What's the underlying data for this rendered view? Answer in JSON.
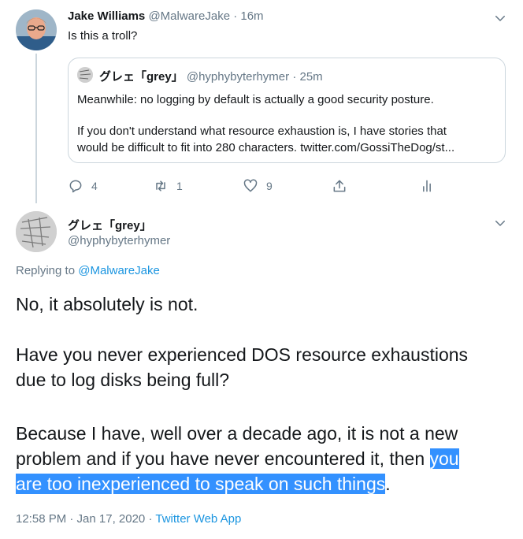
{
  "parent_tweet": {
    "author_name": "Jake Williams",
    "author_handle": "@MalwareJake",
    "separator": "·",
    "time": "16m",
    "text": "Is this a troll?",
    "quoted": {
      "author_name": "グレェ「grey」",
      "author_handle": "@hyphybyterhymer",
      "separator": "·",
      "time": "25m",
      "line1": "Meanwhile: no logging by default is actually a good security posture.",
      "line2": "If you don't understand what resource exhaustion is, I have stories that",
      "line3": "would be difficult to fit into 280 characters. twitter.com/GossiTheDog/st..."
    },
    "actions": {
      "replies": "4",
      "retweets": "1",
      "likes": "9"
    }
  },
  "main_tweet": {
    "author_name": "グレェ「grey」",
    "author_handle": "@hyphybyterhymer",
    "replying_prefix": "Replying to ",
    "replying_to": "@MalwareJake",
    "p1": "No, it absolutely is not.",
    "p2_l1": "Have you never experienced DOS resource exhaustions",
    "p2_l2": "due to log disks being full?",
    "p3_l1": "Because I have, well over a decade ago, it is not a new",
    "p3_l2a": "problem and if you have never encountered it, then ",
    "p3_l2_hl": "you",
    "p3_l3_hl": "are too inexperienced to speak on such things",
    "p3_l3_end": ".",
    "timestamp": "12:58 PM · Jan 17, 2020",
    "ts_sep": "·",
    "source": "Twitter Web App"
  },
  "icons": {
    "reply": "reply-icon",
    "retweet": "retweet-icon",
    "like": "heart-icon",
    "share": "share-icon",
    "analytics": "analytics-icon",
    "more": "chevron-down-icon"
  },
  "colors": {
    "link": "#1b95e0",
    "muted": "#657786",
    "highlight": "#3391ff",
    "border": "#ccd6dd"
  }
}
